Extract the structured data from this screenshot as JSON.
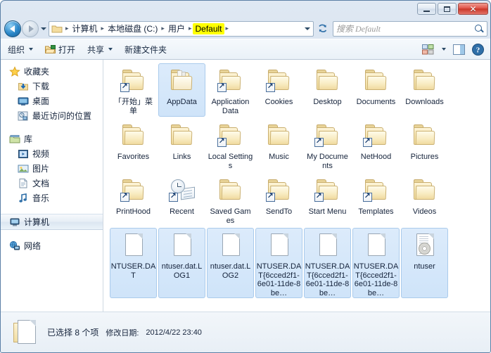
{
  "window": {
    "caption_buttons": [
      {
        "name": "minimize",
        "label": "–"
      },
      {
        "name": "maximize",
        "label": "□"
      },
      {
        "name": "close",
        "label": "✕"
      }
    ]
  },
  "address": {
    "back_tooltip": "后退",
    "forward_tooltip": "前进",
    "crumbs": [
      {
        "label": "计算机",
        "current": false
      },
      {
        "label": "本地磁盘 (C:)",
        "current": false
      },
      {
        "label": "用户",
        "current": false
      },
      {
        "label": "Default",
        "current": true
      }
    ],
    "separator": "▸",
    "dropdown_icon": "chevron-down-icon",
    "refresh_icon": "refresh-icon"
  },
  "search": {
    "placeholder": "搜索 Default",
    "value": "",
    "icon": "search-icon"
  },
  "toolbar": {
    "items": [
      {
        "name": "organize",
        "label": "组织",
        "has_caret": true,
        "icon": null
      },
      {
        "name": "open",
        "label": "打开",
        "has_caret": false,
        "icon": "open-folder-icon"
      },
      {
        "name": "share",
        "label": "共享",
        "has_caret": true,
        "icon": null
      },
      {
        "name": "new-folder",
        "label": "新建文件夹",
        "has_caret": false,
        "icon": null
      }
    ],
    "right": [
      {
        "name": "change-view",
        "icon": "view-icon",
        "has_caret": true
      },
      {
        "name": "preview-pane",
        "icon": "preview-pane-icon",
        "has_caret": false
      },
      {
        "name": "help",
        "icon": "help-icon",
        "has_caret": false
      }
    ]
  },
  "navpane": {
    "groups": [
      {
        "header": {
          "label": "收藏夹",
          "icon": "star-icon"
        },
        "items": [
          {
            "label": "下载",
            "icon": "downloads-icon"
          },
          {
            "label": "桌面",
            "icon": "desktop-icon"
          },
          {
            "label": "最近访问的位置",
            "icon": "recent-places-icon"
          }
        ]
      },
      {
        "header": {
          "label": "库",
          "icon": "library-icon"
        },
        "items": [
          {
            "label": "视频",
            "icon": "video-icon"
          },
          {
            "label": "图片",
            "icon": "pictures-icon"
          },
          {
            "label": "文档",
            "icon": "documents-icon"
          },
          {
            "label": "音乐",
            "icon": "music-icon"
          }
        ]
      },
      {
        "header": {
          "label": "计算机",
          "icon": "computer-icon",
          "selected": true
        },
        "items": []
      },
      {
        "header": {
          "label": "网络",
          "icon": "network-icon"
        },
        "items": []
      }
    ]
  },
  "files": [
    {
      "name": "「开始」菜单",
      "type": "folder",
      "shortcut": true,
      "selected": false
    },
    {
      "name": "AppData",
      "type": "folder-open",
      "shortcut": false,
      "selected": true
    },
    {
      "name": "Application Data",
      "type": "folder",
      "shortcut": true,
      "selected": false
    },
    {
      "name": "Cookies",
      "type": "folder",
      "shortcut": true,
      "selected": false
    },
    {
      "name": "Desktop",
      "type": "folder",
      "shortcut": false,
      "selected": false
    },
    {
      "name": "Documents",
      "type": "folder",
      "shortcut": false,
      "selected": false
    },
    {
      "name": "Downloads",
      "type": "folder",
      "shortcut": false,
      "selected": false
    },
    {
      "name": "Favorites",
      "type": "folder",
      "shortcut": false,
      "selected": false
    },
    {
      "name": "Links",
      "type": "folder",
      "shortcut": false,
      "selected": false
    },
    {
      "name": "Local Settings",
      "type": "folder",
      "shortcut": true,
      "selected": false
    },
    {
      "name": "Music",
      "type": "folder",
      "shortcut": false,
      "selected": false
    },
    {
      "name": "My Documents",
      "type": "folder",
      "shortcut": true,
      "selected": false
    },
    {
      "name": "NetHood",
      "type": "folder",
      "shortcut": true,
      "selected": false
    },
    {
      "name": "Pictures",
      "type": "folder",
      "shortcut": false,
      "selected": false
    },
    {
      "name": "PrintHood",
      "type": "folder",
      "shortcut": true,
      "selected": false
    },
    {
      "name": "Recent",
      "type": "recent",
      "shortcut": true,
      "selected": false
    },
    {
      "name": "Saved Games",
      "type": "folder",
      "shortcut": false,
      "selected": false
    },
    {
      "name": "SendTo",
      "type": "folder",
      "shortcut": true,
      "selected": false
    },
    {
      "name": "Start Menu",
      "type": "folder",
      "shortcut": true,
      "selected": false
    },
    {
      "name": "Templates",
      "type": "folder",
      "shortcut": true,
      "selected": false
    },
    {
      "name": "Videos",
      "type": "folder",
      "shortcut": false,
      "selected": false
    },
    {
      "name": "NTUSER.DAT",
      "type": "file",
      "shortcut": false,
      "selected": true
    },
    {
      "name": "ntuser.dat.LOG1",
      "type": "file",
      "shortcut": false,
      "selected": true
    },
    {
      "name": "ntuser.dat.LOG2",
      "type": "file",
      "shortcut": false,
      "selected": true
    },
    {
      "name": "NTUSER.DAT{6cced2f1-6e01-11de-8be…",
      "type": "file",
      "shortcut": false,
      "selected": true
    },
    {
      "name": "NTUSER.DAT{6cced2f1-6e01-11de-8be…",
      "type": "file",
      "shortcut": false,
      "selected": true
    },
    {
      "name": "NTUSER.DAT{6cced2f1-6e01-11de-8be…",
      "type": "file",
      "shortcut": false,
      "selected": true
    },
    {
      "name": "ntuser",
      "type": "file-config",
      "shortcut": false,
      "selected": true
    }
  ],
  "statusbar": {
    "selection_text": "已选择 8 个项",
    "modified_label": "修改日期:",
    "modified_value": "2012/4/22 23:40"
  },
  "colors": {
    "selection_fill": "#cfe4f9",
    "selection_border": "#aacbec",
    "crumb_highlight": "#ffff00",
    "close_button": "#c93728",
    "folder_yellow": "#f3dfa2",
    "frame_border": "#5b7fa6"
  }
}
